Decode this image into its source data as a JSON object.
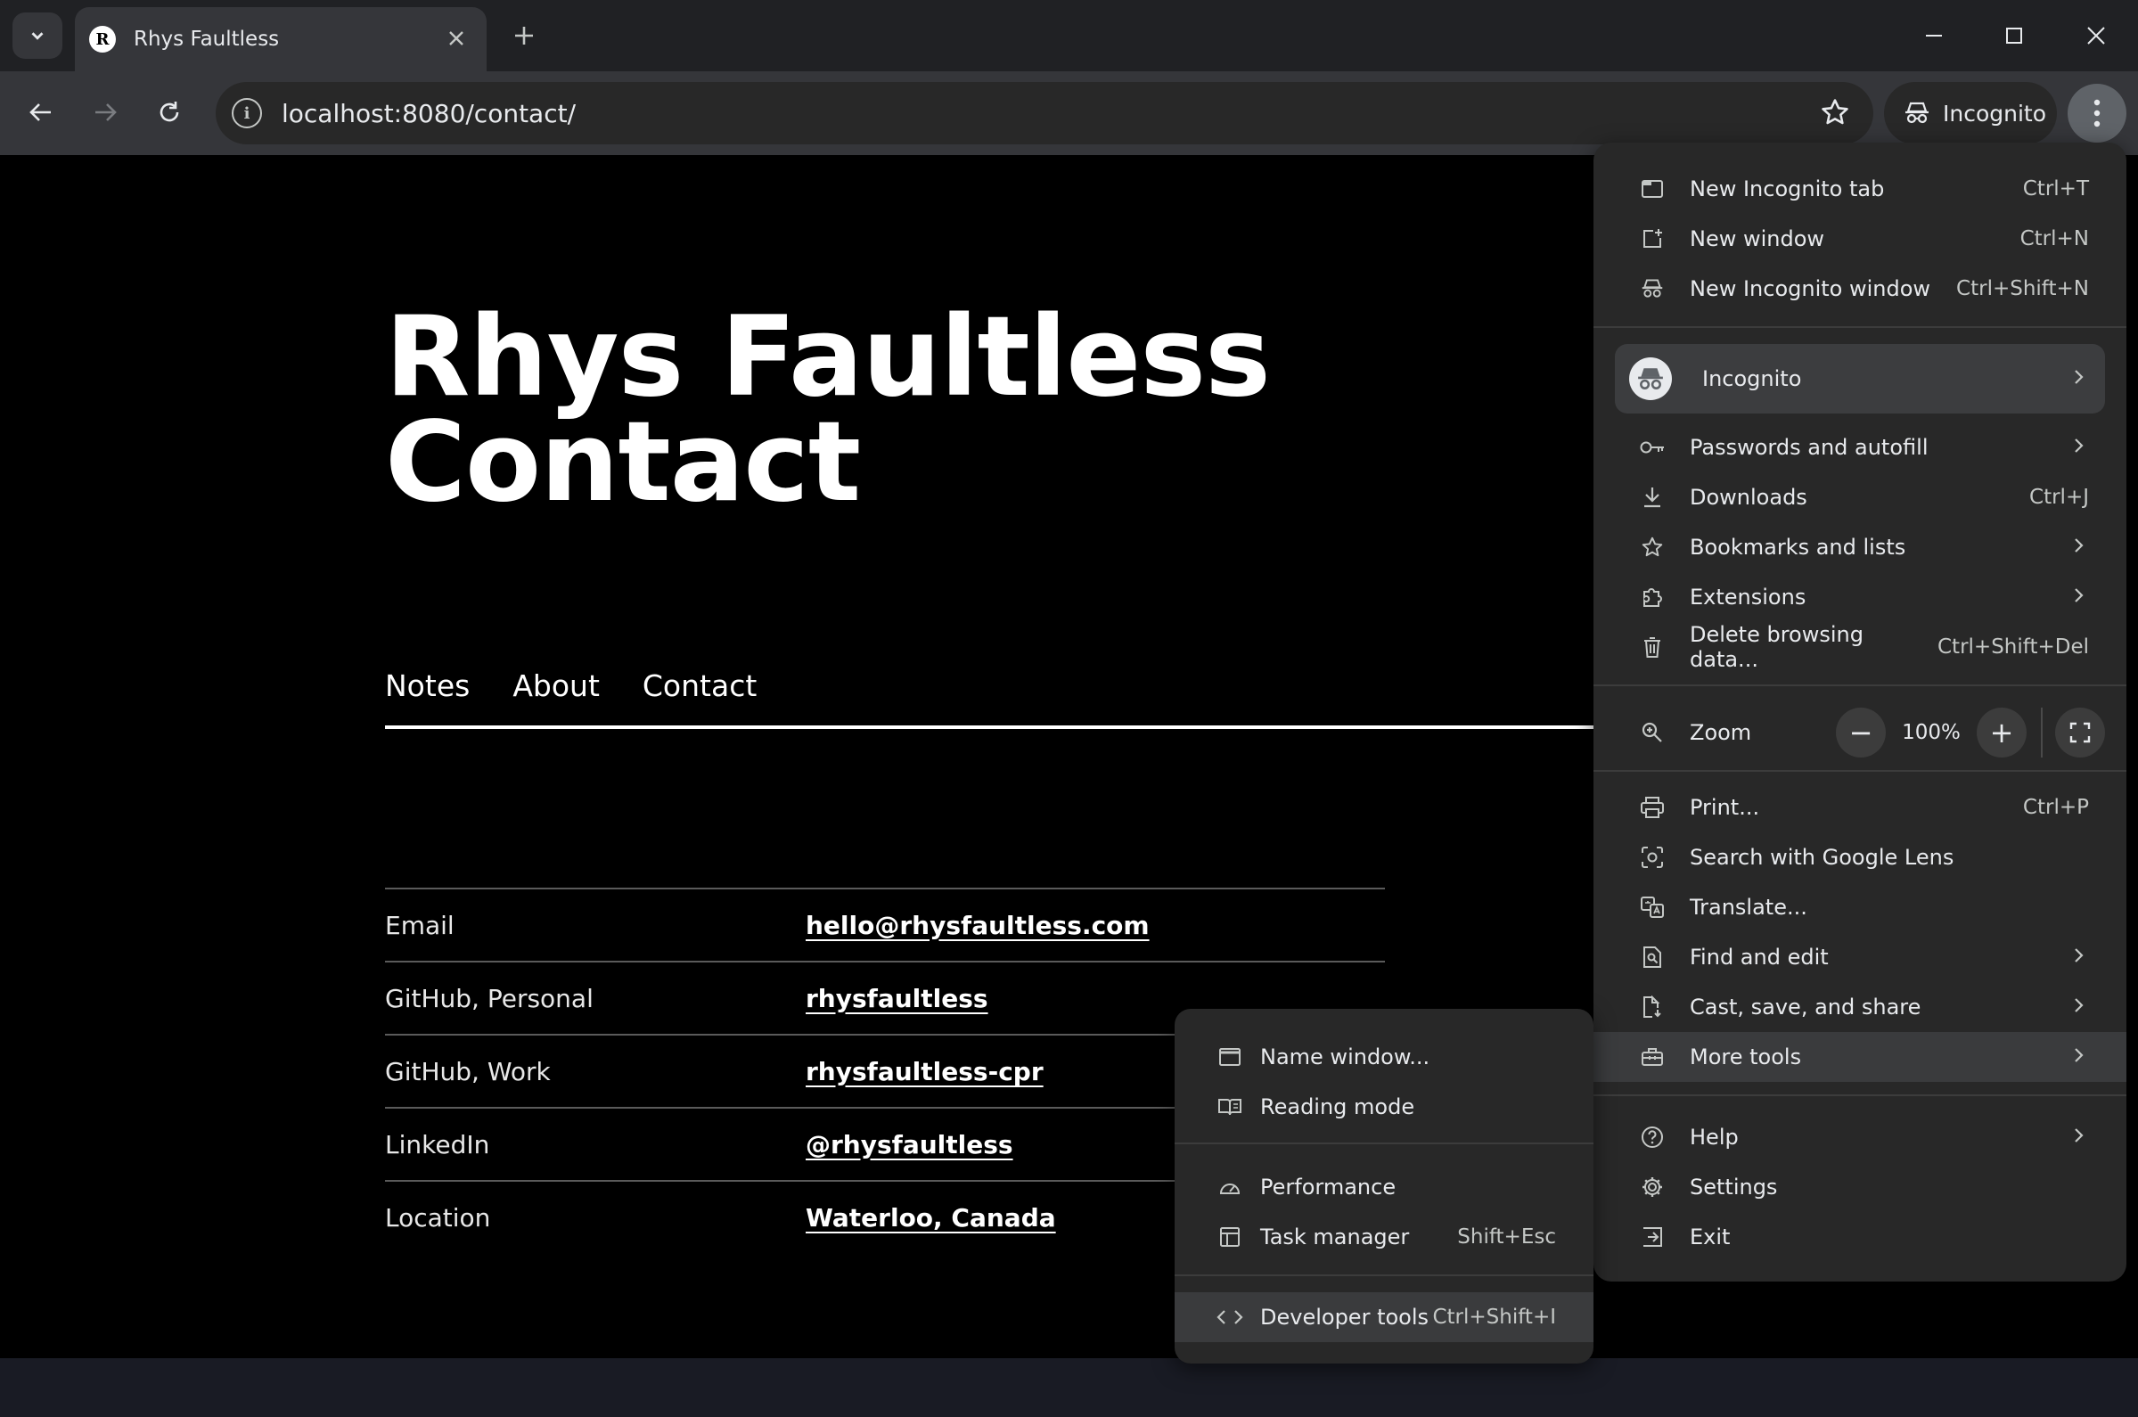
{
  "browser": {
    "tab_title": "Rhys Faultless",
    "tab_favicon_letter": "R",
    "url": "localhost:8080/contact/",
    "profile_chip": "Incognito"
  },
  "page": {
    "title_line1": "Rhys Faultless",
    "title_line2": "Contact",
    "nav": [
      "Notes",
      "About",
      "Contact"
    ],
    "contacts": [
      {
        "label": "Email",
        "value": "hello@rhysfaultless.com"
      },
      {
        "label": "GitHub, Personal",
        "value": "rhysfaultless"
      },
      {
        "label": "GitHub, Work",
        "value": "rhysfaultless-cpr"
      },
      {
        "label": "LinkedIn",
        "value": "@rhysfaultless"
      },
      {
        "label": "Location",
        "value": "Waterloo, Canada"
      }
    ]
  },
  "menu": {
    "new_incognito_tab": {
      "label": "New Incognito tab",
      "shortcut": "Ctrl+T"
    },
    "new_window": {
      "label": "New window",
      "shortcut": "Ctrl+N"
    },
    "new_incognito_window": {
      "label": "New Incognito window",
      "shortcut": "Ctrl+Shift+N"
    },
    "profile": {
      "label": "Incognito"
    },
    "passwords": {
      "label": "Passwords and autofill"
    },
    "downloads": {
      "label": "Downloads",
      "shortcut": "Ctrl+J"
    },
    "bookmarks": {
      "label": "Bookmarks and lists"
    },
    "extensions": {
      "label": "Extensions"
    },
    "delete_data": {
      "label": "Delete browsing data...",
      "shortcut": "Ctrl+Shift+Del"
    },
    "zoom": {
      "label": "Zoom",
      "value": "100%",
      "minus": "−",
      "plus": "+"
    },
    "print": {
      "label": "Print...",
      "shortcut": "Ctrl+P"
    },
    "lens": {
      "label": "Search with Google Lens"
    },
    "translate": {
      "label": "Translate..."
    },
    "find_edit": {
      "label": "Find and edit"
    },
    "cast": {
      "label": "Cast, save, and share"
    },
    "more_tools": {
      "label": "More tools"
    },
    "help": {
      "label": "Help"
    },
    "settings": {
      "label": "Settings"
    },
    "exit": {
      "label": "Exit"
    }
  },
  "submenu": {
    "name_window": {
      "label": "Name window..."
    },
    "reading_mode": {
      "label": "Reading mode"
    },
    "performance": {
      "label": "Performance"
    },
    "task_manager": {
      "label": "Task manager",
      "shortcut": "Shift+Esc"
    },
    "dev_tools": {
      "label": "Developer tools",
      "shortcut": "Ctrl+Shift+I"
    }
  }
}
